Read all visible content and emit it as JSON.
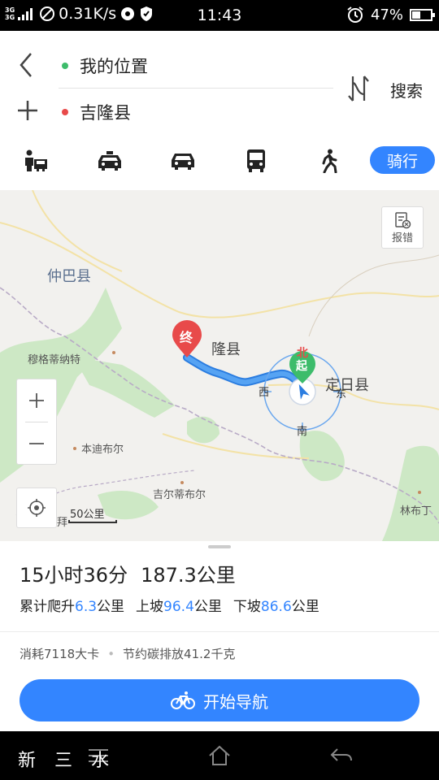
{
  "status_bar": {
    "network_1": "3G",
    "network_2": "3G",
    "speed": "0.31K/s",
    "time": "11:43",
    "battery": "47%",
    "battery_level": 0.47
  },
  "route": {
    "start": "我的位置",
    "end": "吉隆县",
    "search_label": "搜索",
    "start_color": "#3dbc6b",
    "end_color": "#e84a4a"
  },
  "modes": {
    "active_label": "骑行",
    "icons": [
      "person-car-icon",
      "taxi-icon",
      "car-icon",
      "bus-icon",
      "walk-icon"
    ],
    "accent": "#3385ff"
  },
  "map": {
    "report_label": "报错",
    "labels": {
      "zhongba": "仲巴县",
      "jilong": "隆县",
      "dingri": "定日县",
      "muge": "穆格蒂纳特",
      "bendi": "本迪布尔",
      "jier": "吉尔蒂布尔",
      "linbu": "林布丁",
      "bai": "拜"
    },
    "markers": {
      "end": "终",
      "start": "起",
      "north": "北"
    },
    "compass": {
      "east": "东",
      "west": "西",
      "south": "南"
    },
    "scale": "50公里"
  },
  "summary": {
    "duration": "15小时36分",
    "distance": "187.3公里"
  },
  "stats": {
    "climb_label": "累计爬升",
    "climb_value": "6.3",
    "climb_unit": "公里",
    "up_label": "上坡",
    "up_value": "96.4",
    "up_unit": "公里",
    "down_label": "下坡",
    "down_value": "86.6",
    "down_unit": "公里"
  },
  "extra": {
    "calories": "消耗7118大卡",
    "bullet": "•",
    "carbon": "节约碳排放41.2千克"
  },
  "nav_button": {
    "label": "开始导航"
  },
  "watermark": "新 三 水"
}
